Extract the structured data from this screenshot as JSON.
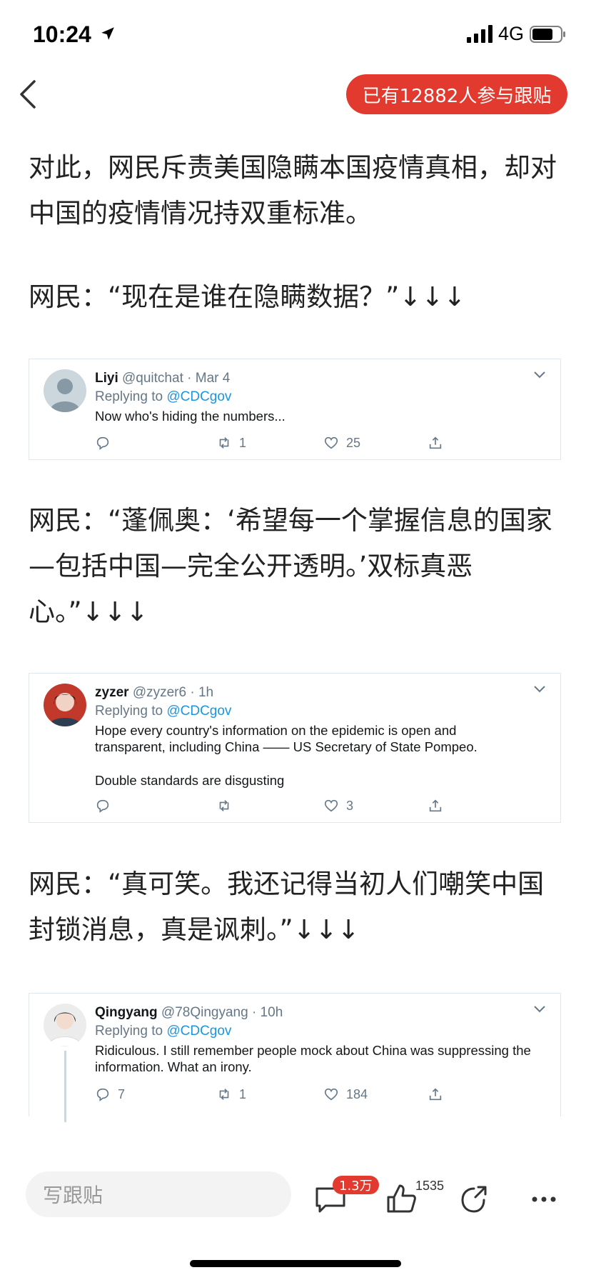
{
  "status_bar": {
    "time": "10:24",
    "network": "4G"
  },
  "header": {
    "follow_count_label": "已有12882人参与跟贴"
  },
  "article": {
    "para1": "对此，网民斥责美国隐瞒本国疫情真相，却对中国的疫情情况持双重标准。",
    "para2": "网民：“现在是谁在隐瞒数据？”↓↓↓",
    "para3": "网民：“蓬佩奥：‘希望每一个掌握信息的国家—包括中国—完全公开透明。’双标真恶心。”↓↓↓",
    "para4": "网民：“真可笑。我还记得当初人们嘲笑中国封锁消息，真是讽刺。”↓↓↓"
  },
  "tweets": [
    {
      "name": "Liyi",
      "handle": "@quitchat",
      "time": "· Mar 4",
      "replying_prefix": "Replying to ",
      "replying_to": "@CDCgov",
      "text": "Now who's hiding the numbers...",
      "reply_count": "",
      "retweet_count": "1",
      "like_count": "25"
    },
    {
      "name": "zyzer",
      "handle": "@zyzer6",
      "time": "· 1h",
      "replying_prefix": "Replying to ",
      "replying_to": "@CDCgov",
      "text_line1": "Hope every country's information on the epidemic is open and",
      "text_line2": "transparent, including China —— US Secretary of State Pompeo.",
      "text_line3": "Double standards are disgusting",
      "reply_count": "",
      "retweet_count": "",
      "like_count": "3"
    },
    {
      "name": "Qingyang",
      "handle": "@78Qingyang",
      "time": "· 10h",
      "replying_prefix": "Replying to ",
      "replying_to": "@CDCgov",
      "text_line1": "Ridiculous. I still remember people mock about China was suppressing the",
      "text_line2": "information. What an irony.",
      "reply_count": "7",
      "retweet_count": "1",
      "like_count": "184"
    }
  ],
  "bottom_bar": {
    "comment_placeholder": "写跟贴",
    "comment_badge": "1.3万",
    "like_count": "1535"
  },
  "icons": {
    "back": "chevron-left-icon",
    "comment": "speech-bubble-icon",
    "like": "thumbs-up-icon",
    "share": "share-arrow-icon",
    "more": "more-dots-icon"
  },
  "colors": {
    "accent": "#e23a2e",
    "twitter_link": "#1b95e0",
    "twitter_gray": "#657786"
  }
}
